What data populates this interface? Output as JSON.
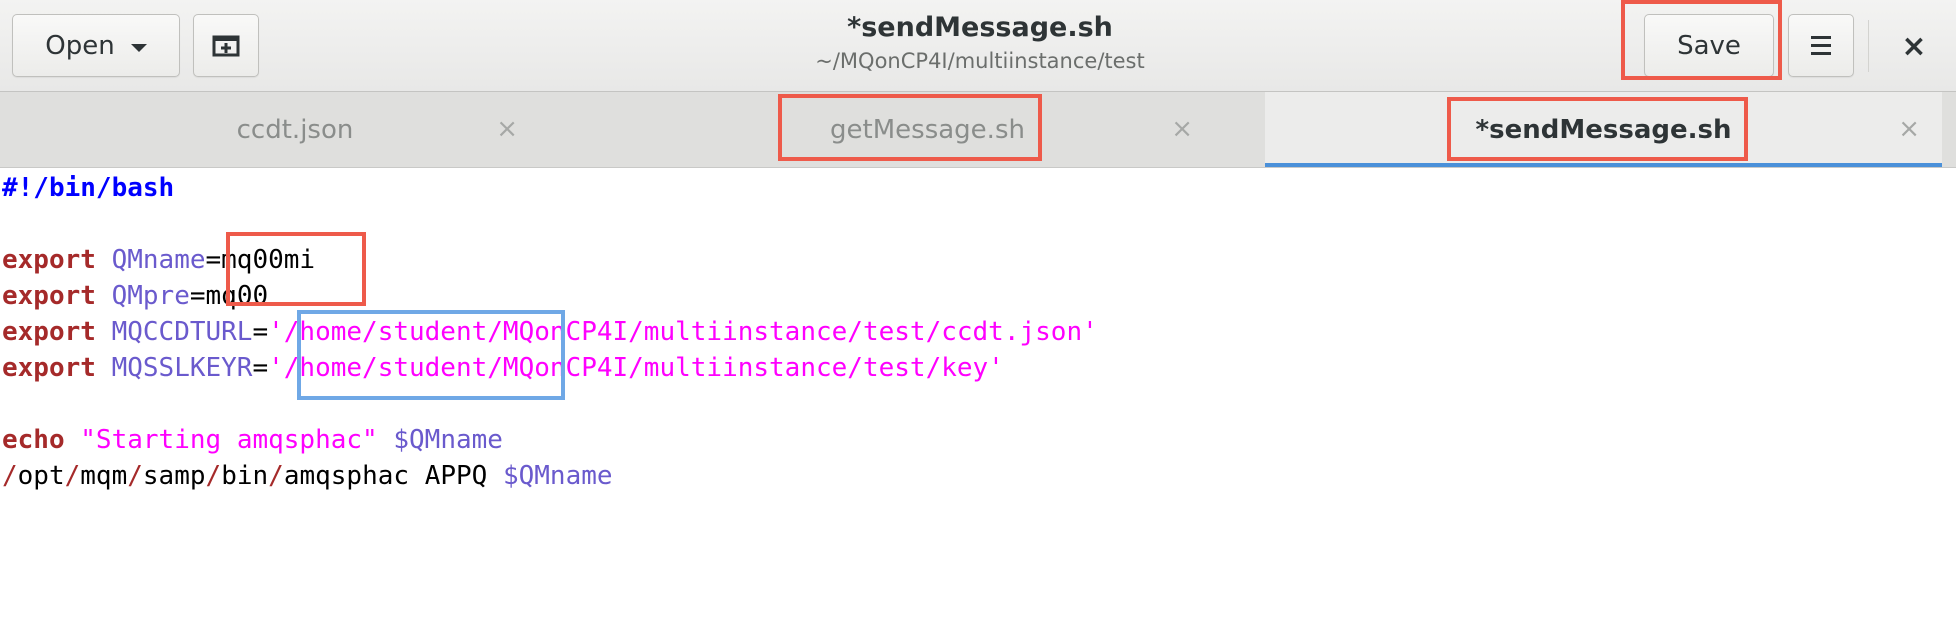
{
  "header": {
    "open_label": "Open",
    "title": "*sendMessage.sh",
    "subtitle": "~/MQonCP4I/multiinstance/test",
    "save_label": "Save",
    "close_glyph": "×"
  },
  "tabs": [
    {
      "label": "ccdt.json",
      "close_glyph": "×",
      "active": false
    },
    {
      "label": "getMessage.sh",
      "close_glyph": "×",
      "active": false
    },
    {
      "label": "*sendMessage.sh",
      "close_glyph": "×",
      "active": true
    }
  ],
  "code": {
    "line1": {
      "shebang": "#!/bin/bash"
    },
    "line3": {
      "kw": "export",
      "var": "QMname",
      "rest": "=mq00mi"
    },
    "line4": {
      "kw": "export",
      "var": "QMpre",
      "rest": "=mq00"
    },
    "line5": {
      "kw": "export",
      "var": "MQCCDTURL",
      "eq": "=",
      "str": "'/home/student/MQonCP4I/multiinstance/test/ccdt.json'"
    },
    "line6": {
      "kw": "export",
      "var": "MQSSLKEYR",
      "eq": "=",
      "str": "'/home/student/MQonCP4I/multiinstance/test/key'"
    },
    "line8": {
      "kw": "echo",
      "str": "\"Starting amqsphac\"",
      "var": "$QMname"
    },
    "line9": {
      "s1": "/",
      "p1": "opt",
      "s2": "/",
      "p2": "mqm",
      "s3": "/",
      "p3": "samp",
      "s4": "/",
      "p4": "bin",
      "s5": "/",
      "cmd": "amqsphac APPQ ",
      "var": "$QMname"
    }
  },
  "colors": {
    "keyword": "#a52a2a",
    "shebang": "#0000ff",
    "variable": "#6a5acd",
    "string": "#ff00ff",
    "highlight_red": "#ee5a4a",
    "highlight_blue": "#6fa8e6",
    "tab_underline": "#4a90d9"
  },
  "icons": {
    "open_caret": "chevron-down-icon",
    "new_tab": "new-document-icon",
    "menu": "hamburger-menu-icon",
    "close": "close-icon"
  }
}
